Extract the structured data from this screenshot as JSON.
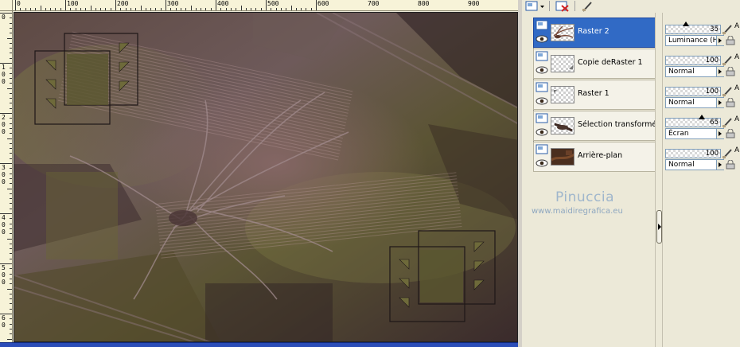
{
  "ruler": {
    "top_labels": [
      "0",
      "100",
      "200",
      "300",
      "400",
      "500",
      "600",
      "700",
      "800",
      "900"
    ],
    "left_labels": [
      [
        "0"
      ],
      [
        "1",
        "0",
        "0"
      ],
      [
        "2",
        "0",
        "0"
      ],
      [
        "3",
        "0",
        "0"
      ],
      [
        "4",
        "0",
        "0"
      ],
      [
        "5",
        "0",
        "0"
      ],
      [
        "6",
        "0"
      ]
    ]
  },
  "layers": [
    {
      "name": "Raster 2",
      "selected": true,
      "type": "raster",
      "thumb": "brush"
    },
    {
      "name": "Copie deRaster 1",
      "selected": false,
      "type": "raster",
      "thumb": "empty"
    },
    {
      "name": "Raster 1",
      "selected": false,
      "type": "raster",
      "thumb": "empty"
    },
    {
      "name": "Sélection transformée",
      "selected": false,
      "type": "raster",
      "thumb": "stroke"
    },
    {
      "name": "Arrière-plan",
      "selected": false,
      "type": "raster",
      "thumb": "image"
    }
  ],
  "properties": [
    {
      "opacity": "35",
      "blend": "Luminance (H)"
    },
    {
      "opacity": "100",
      "blend": "Normal"
    },
    {
      "opacity": "100",
      "blend": "Normal"
    },
    {
      "opacity": "65",
      "blend": "Écran"
    },
    {
      "opacity": "100",
      "blend": "Normal"
    }
  ],
  "watermark": {
    "name": "Pinuccia",
    "url": "www.maidiregrafica.eu"
  },
  "property_letter": "A",
  "colors": {
    "selection": "#316ac5",
    "panel": "#ece9d8",
    "ruler": "#f7f3d8",
    "canvas_base": "#4a3a38",
    "olive": "#6b6a38",
    "mauve": "#7a5a5c"
  },
  "icons": {
    "toolbar": [
      "new-layer-icon",
      "dropdown-arrow-icon",
      "delete-layer-icon",
      "brush-icon"
    ],
    "layer_row": [
      "raster-layer-icon",
      "visibility-eye-icon"
    ],
    "property_row": [
      "brush-icon",
      "lock-icon"
    ]
  }
}
